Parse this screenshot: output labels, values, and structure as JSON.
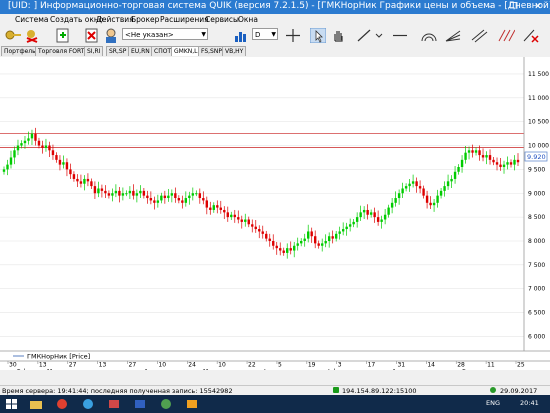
{
  "window": {
    "title": "[UID:       ] Информационно-торговая система QUIK (версия 7.2.1.5) - [ГМКНорНик Графики цены и объема - [Дневной]]",
    "minimize": "–",
    "restore": "❐",
    "close": "✕"
  },
  "menu": [
    "Система",
    "Создать окно",
    "Действия",
    "Брокер",
    "Расширения",
    "Сервисы",
    "Окна"
  ],
  "toolbar": {
    "broker_combo": "<Не указан>",
    "period_combo": "D"
  },
  "tabs": [
    {
      "label": "Портфель"
    },
    {
      "label": "Торговля FORTS"
    },
    {
      "label": "SI,RI"
    },
    {
      "label": "SR,SP"
    },
    {
      "label": "EU,RN"
    },
    {
      "label": "СПОТ"
    },
    {
      "label": "GMKN,LK"
    },
    {
      "label": "FS,SNP"
    },
    {
      "label": "VB,HY"
    }
  ],
  "legend_label": "ГМКНорНик [Price]",
  "price_badge": "9.920",
  "status": {
    "server_time": "Время сервера: 19:41:44; последняя полученная запись: 15542982",
    "connection": "194.154.89.122:15100",
    "date": "29.09.2017"
  },
  "taskbar": {
    "lang": "ENG",
    "time": "20:41"
  },
  "colors": {
    "up": "#00cc00",
    "down": "#dd0000",
    "level": "#d04040",
    "titlebar": "#2b7bd0"
  },
  "chart_data": {
    "type": "candlestick",
    "y_ticks": [
      "11 500",
      "11 000",
      "10 500",
      "10 000",
      "9 500",
      "9 000",
      "8 500",
      "8 000",
      "7 500",
      "7 000",
      "6 500",
      "6 000"
    ],
    "ylim": [
      5800,
      11750
    ],
    "date_ticks": [
      "30",
      "13",
      "27",
      "13",
      "27",
      "10",
      "24",
      "10",
      "22",
      "5",
      "19",
      "3",
      "17",
      "31",
      "14",
      "28",
      "11",
      "25"
    ],
    "month_labels": [
      "Jan",
      "Feb",
      "Mar",
      "Apr",
      "May",
      "Jun",
      "Jul",
      "Aug",
      "Sep"
    ],
    "horizontal_levels": [
      10250,
      9960
    ],
    "closes": [
      9500,
      9600,
      9750,
      9900,
      10000,
      10050,
      10100,
      10150,
      10250,
      10100,
      10000,
      9950,
      10000,
      9900,
      9800,
      9700,
      9600,
      9650,
      9500,
      9400,
      9300,
      9250,
      9200,
      9300,
      9250,
      9150,
      9000,
      9100,
      9050,
      9000,
      8950,
      9000,
      9050,
      8950,
      9000,
      9000,
      9050,
      8950,
      9000,
      9050,
      8950,
      8900,
      8850,
      8800,
      8850,
      8950,
      8900,
      8950,
      9000,
      8900,
      8850,
      8800,
      8900,
      8950,
      9000,
      9000,
      8900,
      8850,
      8700,
      8650,
      8750,
      8700,
      8650,
      8600,
      8500,
      8550,
      8500,
      8450,
      8400,
      8450,
      8350,
      8300,
      8250,
      8200,
      8150,
      8050,
      8000,
      7900,
      7850,
      7800,
      7750,
      7850,
      7800,
      7900,
      7950,
      8000,
      8050,
      8200,
      8100,
      7950,
      7900,
      7950,
      8000,
      8100,
      8050,
      8150,
      8200,
      8250,
      8300,
      8350,
      8400,
      8500,
      8600,
      8650,
      8550,
      8600,
      8500,
      8400,
      8450,
      8550,
      8700,
      8800,
      8900,
      9000,
      9100,
      9150,
      9200,
      9250,
      9150,
      9100,
      8950,
      8800,
      8750,
      8800,
      8950,
      9050,
      9150,
      9250,
      9300,
      9450,
      9550,
      9700,
      9850,
      9900,
      9850,
      9900,
      9800,
      9750,
      9800,
      9700,
      9650,
      9600,
      9550,
      9600,
      9650,
      9600,
      9700,
      9650
    ]
  }
}
